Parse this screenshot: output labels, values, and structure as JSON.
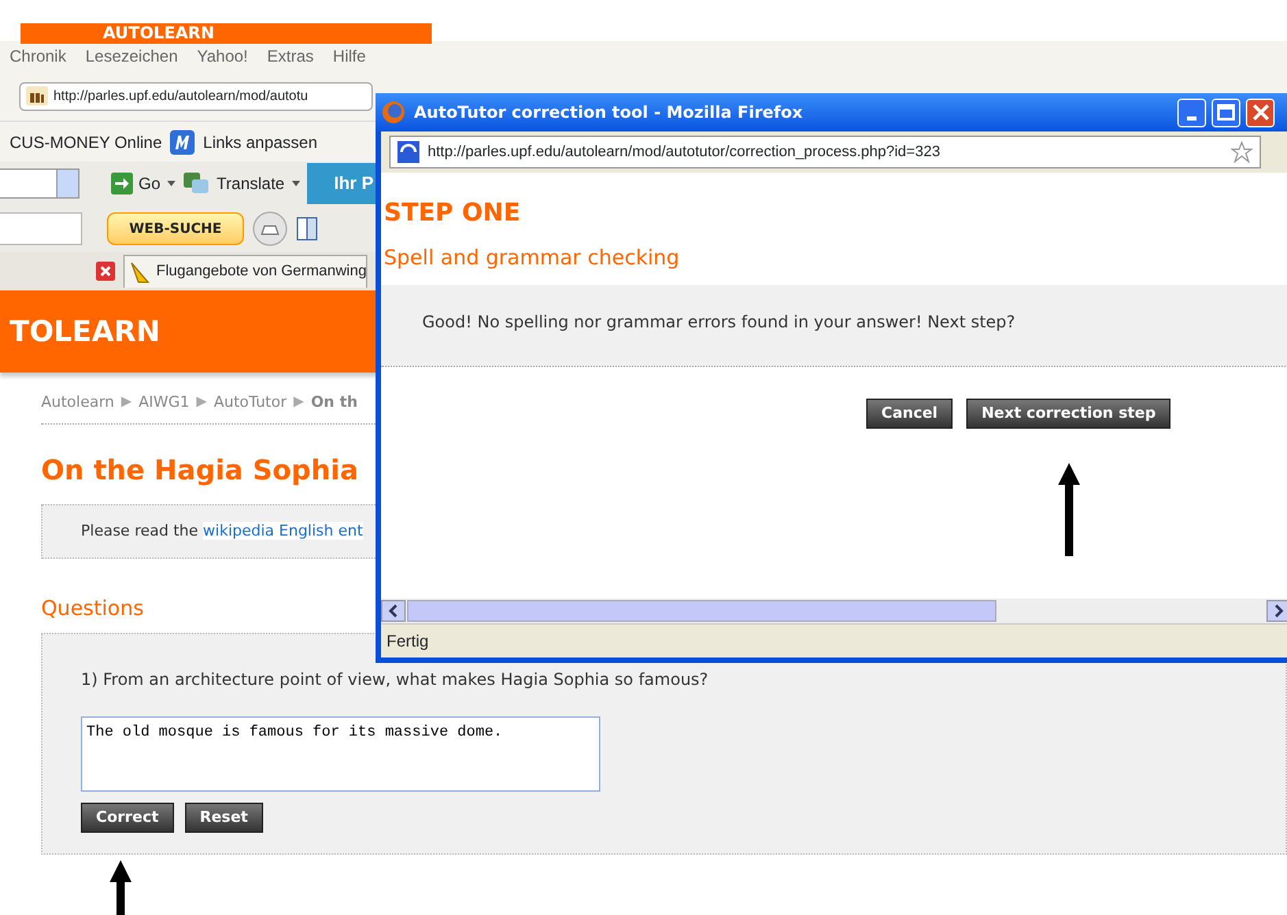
{
  "browser": {
    "banner_text": "AUTOLEARN",
    "menu": [
      "Chronik",
      "Lesezeichen",
      "Yahoo!",
      "Extras",
      "Hilfe"
    ],
    "address": "http://parles.upf.edu/autolearn/mod/autotu",
    "bookmarks": [
      "CUS-MONEY Online",
      "Links anpassen"
    ],
    "toolbar": {
      "go": "Go",
      "translate": "Translate",
      "promo": "Ihr P"
    },
    "search_button": "WEB-SUCHE",
    "tab_title": "Flugangebote von Germanwing"
  },
  "page": {
    "site_title": "TOLEARN",
    "breadcrumb": [
      {
        "label": "Autolearn",
        "current": false
      },
      {
        "label": "AIWG1",
        "current": false
      },
      {
        "label": "AutoTutor",
        "current": false
      },
      {
        "label": "On th",
        "current": true
      }
    ],
    "separator": "▶",
    "heading": "On the Hagia Sophia",
    "intro": {
      "text": "Please read the",
      "link": "wikipedia English ent"
    },
    "questions_heading": "Questions",
    "question": "1) From an architecture point of view, what makes Hagia Sophia so famous?",
    "answer": "The old mosque is famous for its massive dome.",
    "buttons": [
      "Correct",
      "Reset"
    ]
  },
  "popup": {
    "title": "AutoTutor correction tool - Mozilla Firefox",
    "address": "http://parles.upf.edu/autolearn/mod/autotutor/correction_process.php?id=323",
    "step": "STEP ONE",
    "subtitle": "Spell and grammar checking",
    "message": "Good! No spelling nor grammar errors found in your answer! Next step?",
    "buttons": [
      "Cancel",
      "Next correction step"
    ],
    "status": "Fertig"
  }
}
